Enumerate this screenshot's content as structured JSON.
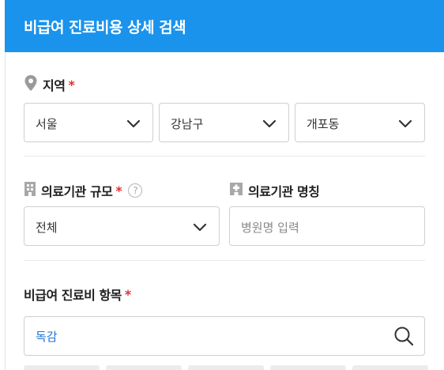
{
  "header": {
    "title": "비급여 진료비용 상세 검색"
  },
  "region": {
    "label": "지역",
    "required_mark": "*",
    "sido": "서울",
    "sigungu": "강남구",
    "dong": "개포동"
  },
  "facility_scale": {
    "label": "의료기관 규모",
    "required_mark": "*",
    "help_symbol": "?",
    "value": "전체"
  },
  "facility_name": {
    "label": "의료기관 명칭",
    "placeholder": "병원명 입력"
  },
  "item": {
    "label": "비급여 진료비 항목",
    "required_mark": "*",
    "value": "독감"
  }
}
